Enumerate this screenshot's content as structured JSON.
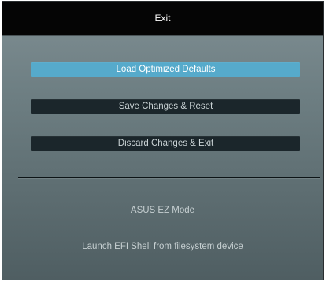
{
  "dialog": {
    "title": "Exit"
  },
  "buttons": [
    {
      "label": "Load Optimized Defaults",
      "selected": true
    },
    {
      "label": "Save Changes & Reset",
      "selected": false
    },
    {
      "label": "Discard Changes & Exit",
      "selected": false
    }
  ],
  "items": [
    {
      "label": "ASUS EZ Mode"
    },
    {
      "label": "Launch EFI Shell from filesystem device"
    }
  ],
  "colors": {
    "selected_background": "#56aacb",
    "button_background": "#1b262b",
    "titlebar_background": "#050505"
  }
}
